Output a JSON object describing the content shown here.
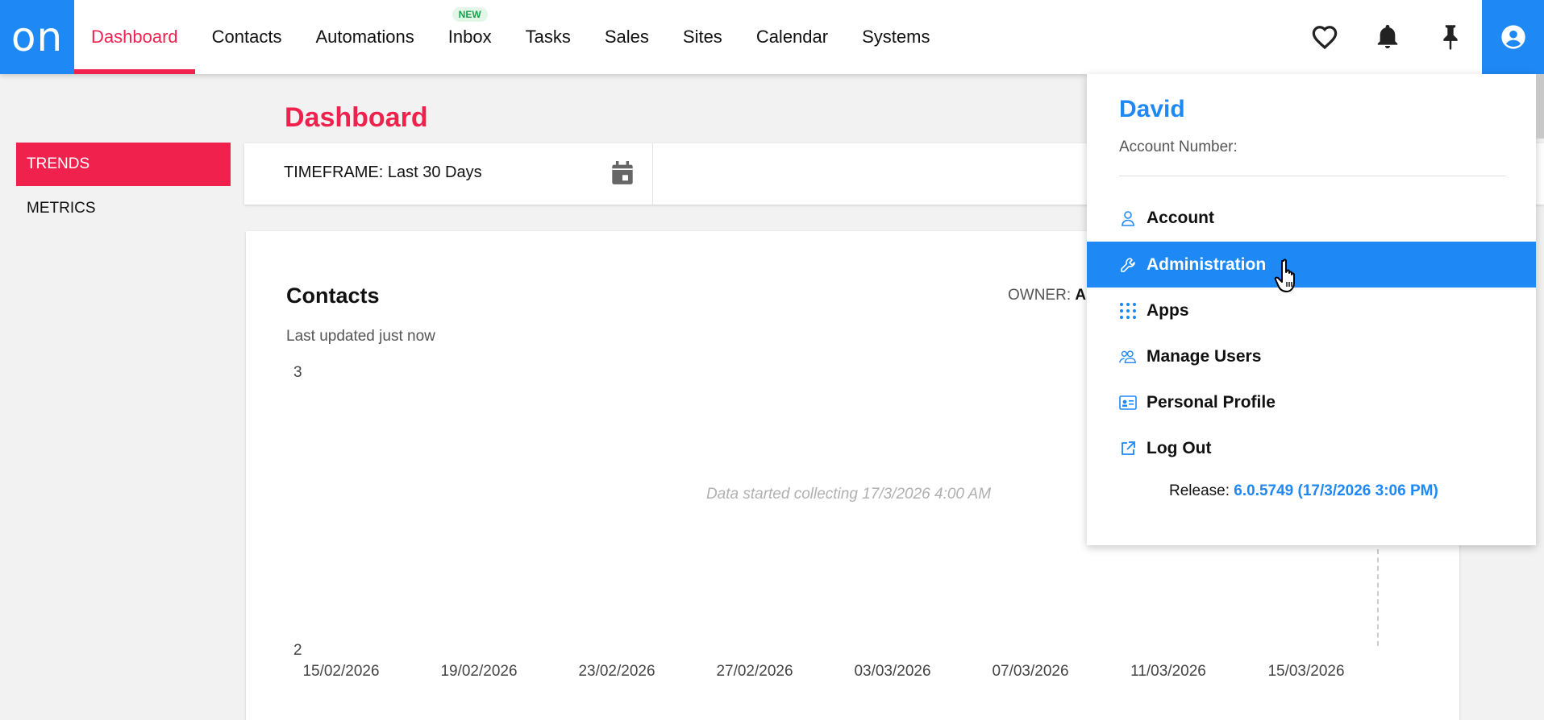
{
  "logo": "on",
  "nav": {
    "items": [
      {
        "label": "Dashboard"
      },
      {
        "label": "Contacts"
      },
      {
        "label": "Automations"
      },
      {
        "label": "Inbox",
        "badge": "NEW"
      },
      {
        "label": "Tasks"
      },
      {
        "label": "Sales"
      },
      {
        "label": "Sites"
      },
      {
        "label": "Calendar"
      },
      {
        "label": "Systems"
      }
    ],
    "icons": [
      "heart-icon",
      "bell-icon",
      "pin-icon",
      "user-icon"
    ]
  },
  "sidebar": {
    "items": [
      {
        "label": "TRENDS"
      },
      {
        "label": "METRICS"
      }
    ]
  },
  "page": {
    "title": "Dashboard"
  },
  "timeframe": {
    "label": "TIMEFRAME: Last 30 Days"
  },
  "card": {
    "title": "Contacts",
    "updated": "Last updated just now",
    "owner_label": "OWNER:",
    "owner_value": "A",
    "empty_note": "Data started collecting 17/3/2026 4:00 AM"
  },
  "chart_data": {
    "type": "line",
    "x_ticks": [
      "15/02/2026",
      "19/02/2026",
      "23/02/2026",
      "27/02/2026",
      "03/03/2026",
      "07/03/2026",
      "11/03/2026",
      "15/03/2026"
    ],
    "y_ticks": [
      "3",
      "2"
    ],
    "ylim": [
      2,
      3
    ],
    "series": []
  },
  "dropdown": {
    "name": "David",
    "account_number_label": "Account Number:",
    "items": [
      {
        "label": "Account",
        "icon": "person-icon"
      },
      {
        "label": "Administration",
        "icon": "wrench-icon"
      },
      {
        "label": "Apps",
        "icon": "grid-icon"
      },
      {
        "label": "Manage Users",
        "icon": "users-icon"
      },
      {
        "label": "Personal Profile",
        "icon": "id-card-icon"
      },
      {
        "label": "Log Out",
        "icon": "external-link-icon"
      }
    ],
    "release_label": "Release:",
    "release_value": "6.0.5749 (17/3/2026 3:06 PM)"
  },
  "colors": {
    "brand_blue": "#1e88f5",
    "accent_red": "#f0224d",
    "badge_green": "#16a34a"
  }
}
